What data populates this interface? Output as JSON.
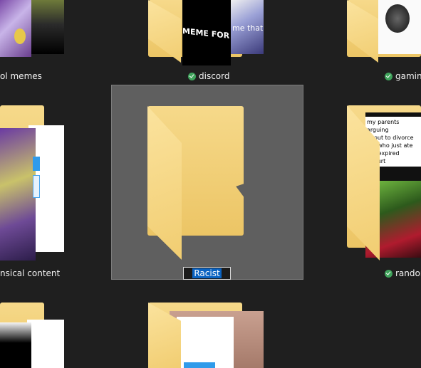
{
  "folders": {
    "top_left": {
      "label": "ol memes"
    },
    "top_middle": {
      "label": "discord",
      "thumb_text_1": "MEME FOR THA",
      "thumb_text_2": "me that"
    },
    "top_right": {
      "label": "gamin"
    },
    "mid_left": {
      "label": "nsical content"
    },
    "selected": {
      "rename_value": "Racist"
    },
    "mid_right": {
      "label": "randor",
      "thumb_lines": [
        "my parents arguing",
        "about to divorce",
        "me who just ate",
        "the expired yogurt"
      ]
    }
  },
  "colors": {
    "background": "#1f1f1f",
    "selection": "#5f5f5f",
    "sync_ok": "#3fa35b",
    "text_selection": "#0a63c2"
  },
  "icons": {
    "sync_status": "check-circle-icon",
    "folder": "folder-icon"
  }
}
